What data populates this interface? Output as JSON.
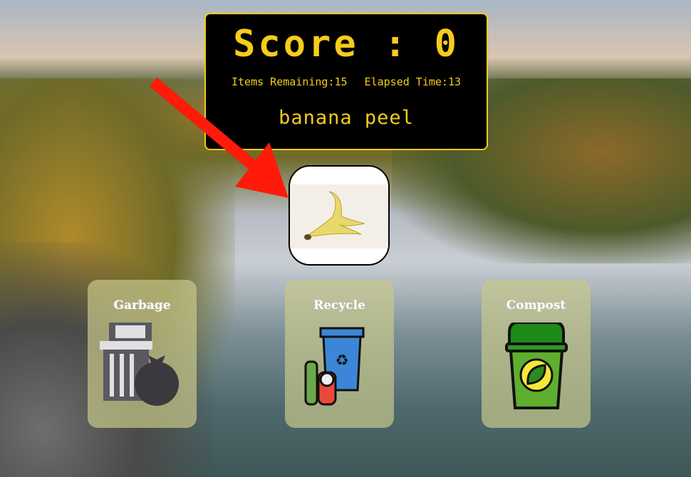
{
  "scoreboard": {
    "score_label": "Score : 0",
    "items_remaining": "Items Remaining:15",
    "elapsed_time": "Elapsed Time:13",
    "current_item": "banana peel"
  },
  "bins": [
    {
      "label": "Garbage"
    },
    {
      "label": "Recycle"
    },
    {
      "label": "Compost"
    }
  ],
  "colors": {
    "accent": "#f7cc1a",
    "arrow": "#ff1a0a"
  }
}
